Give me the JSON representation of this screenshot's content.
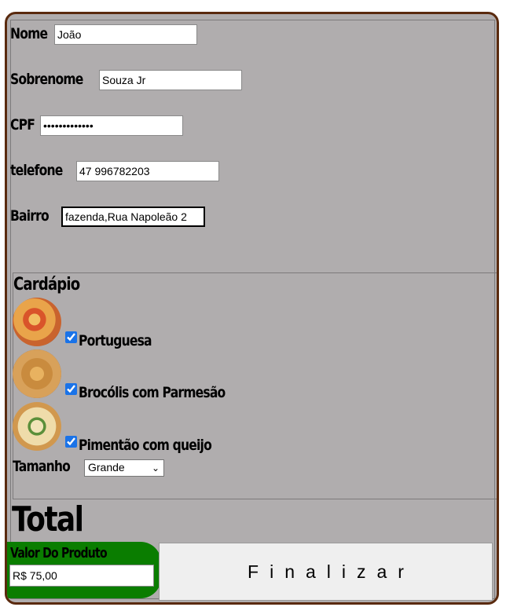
{
  "form": {
    "nome": {
      "label": "Nome",
      "value": "João"
    },
    "sobrenome": {
      "label": "Sobrenome",
      "value": "Souza Jr"
    },
    "cpf": {
      "label": "CPF",
      "value": "•••••••••••••"
    },
    "telefone": {
      "label": "telefone",
      "value": "47 996782203"
    },
    "bairro": {
      "label": "Bairro",
      "value": "fazenda,Rua Napoleão 2"
    }
  },
  "cardapio": {
    "legend": "Cardápio",
    "items": [
      {
        "label": "Portuguesa",
        "checked": true,
        "image": "pizza-portuguesa"
      },
      {
        "label": "Brocólis com Parmesão",
        "checked": true,
        "image": "pizza-brocolis"
      },
      {
        "label": "Pimentão com queijo",
        "checked": true,
        "image": "pizza-pimentao"
      }
    ],
    "tamanho": {
      "label": "Tamanho",
      "selected": "Grande"
    }
  },
  "total": {
    "heading": "Total",
    "valor_label": "Valor Do Produto",
    "valor": "R$ 75,00",
    "valor_bg": "#0a7d00"
  },
  "actions": {
    "finalizar": "Finalizar"
  },
  "colors": {
    "background": "#b0adae",
    "border": "#5a2a0e"
  }
}
